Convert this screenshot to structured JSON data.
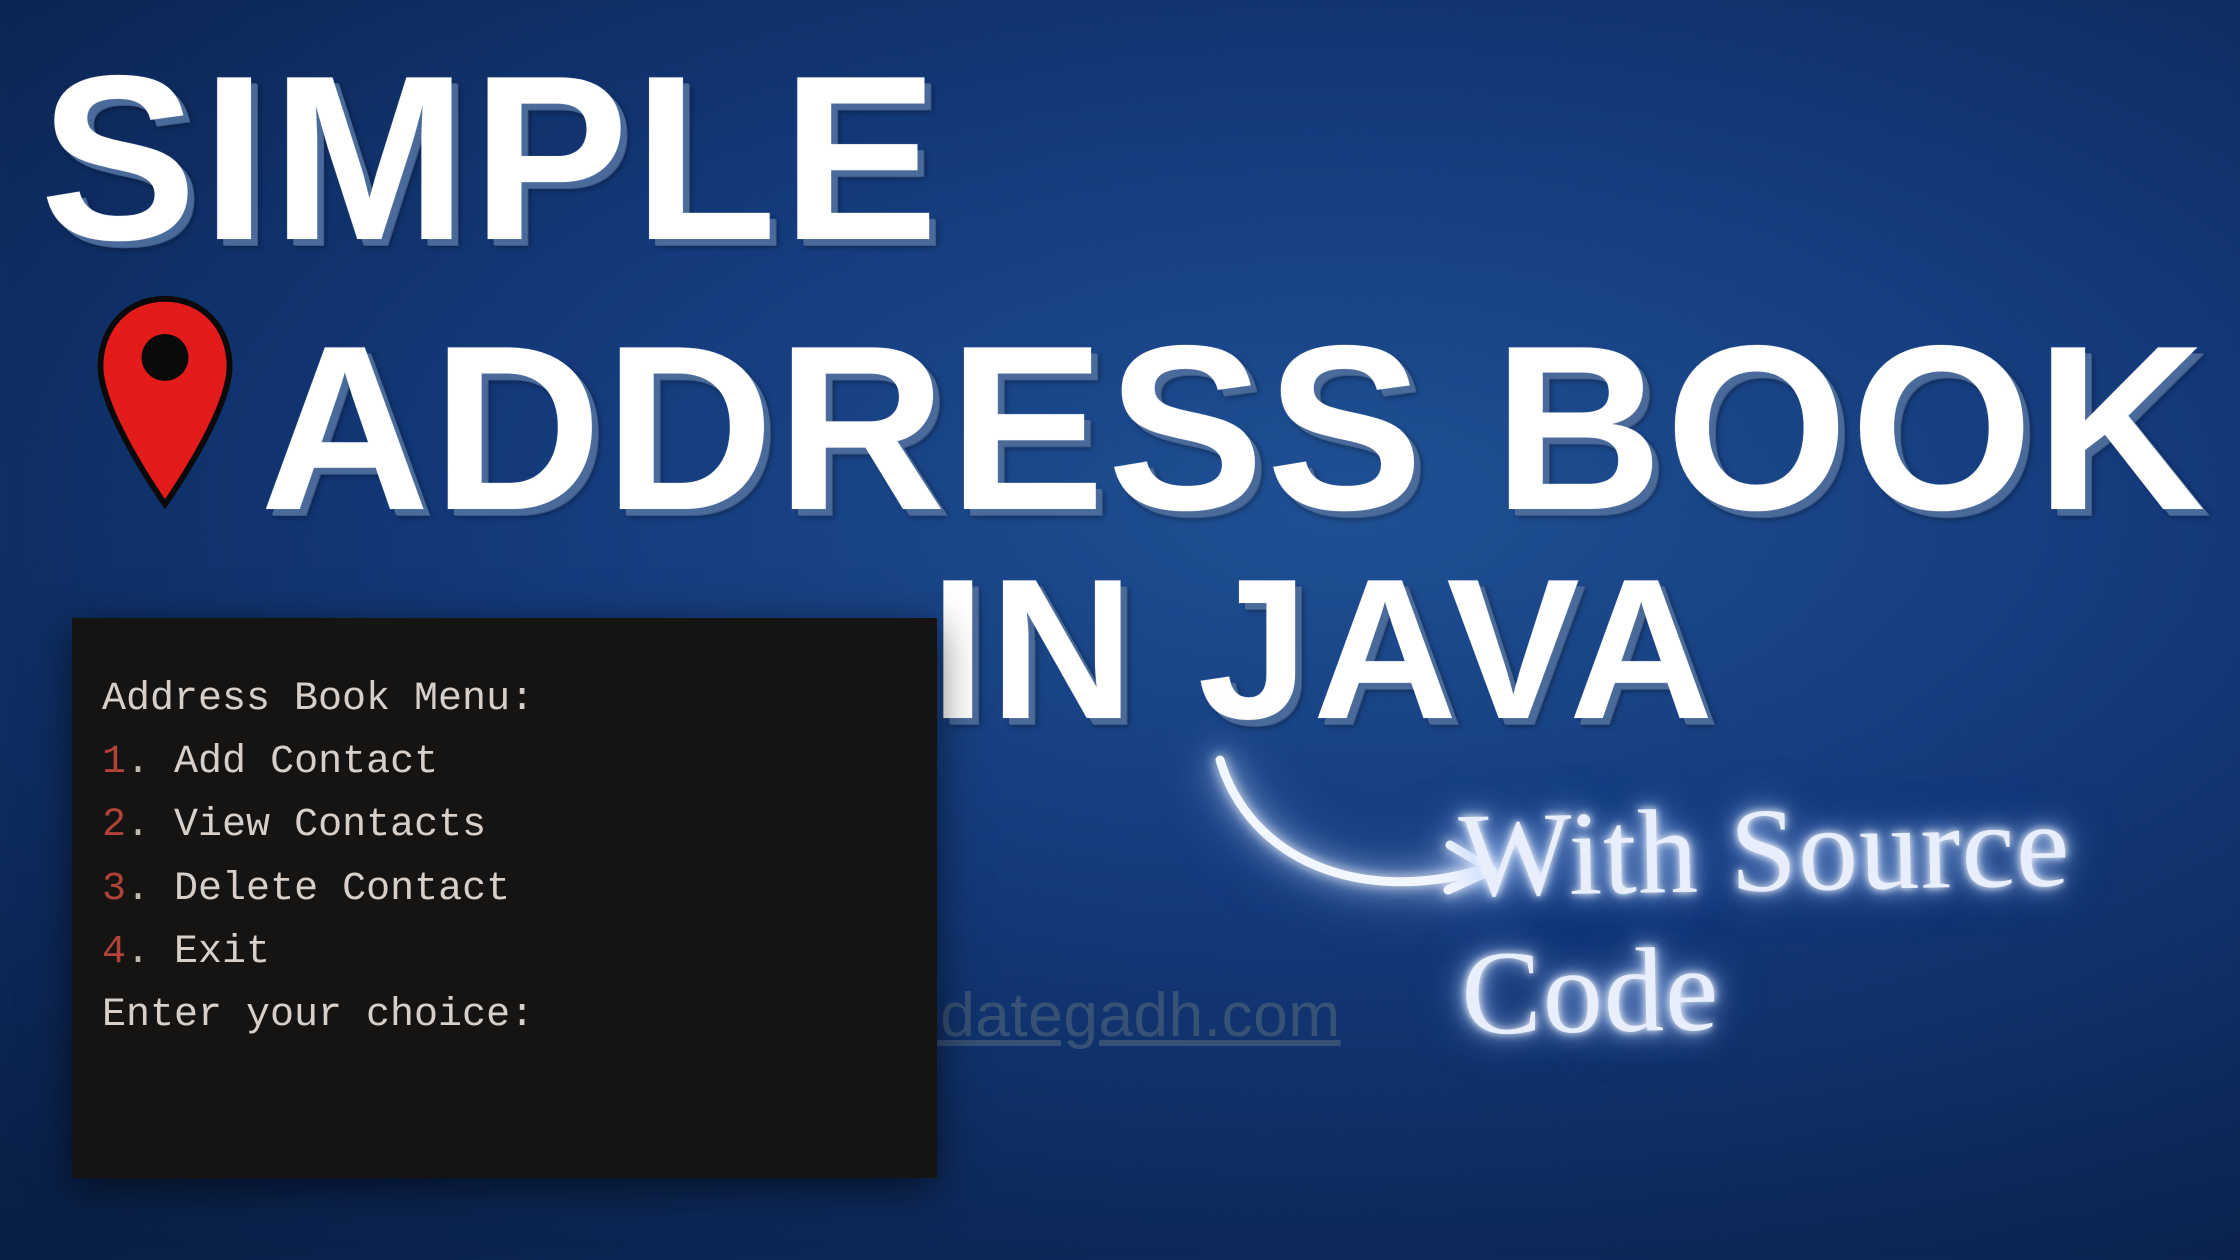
{
  "heading": {
    "line1": "SIMPLE",
    "line2": "ADDRESS BOOK",
    "line3": "IN JAVA"
  },
  "handwritten": "With Source Code",
  "watermark": "updategadh.com",
  "terminal": {
    "title": "Address Book Menu:",
    "items": [
      {
        "n": "1",
        "label": "Add Contact"
      },
      {
        "n": "2",
        "label": "View Contacts"
      },
      {
        "n": "3",
        "label": "Delete Contact"
      },
      {
        "n": "4",
        "label": "Exit"
      }
    ],
    "prompt": "Enter your choice:"
  }
}
